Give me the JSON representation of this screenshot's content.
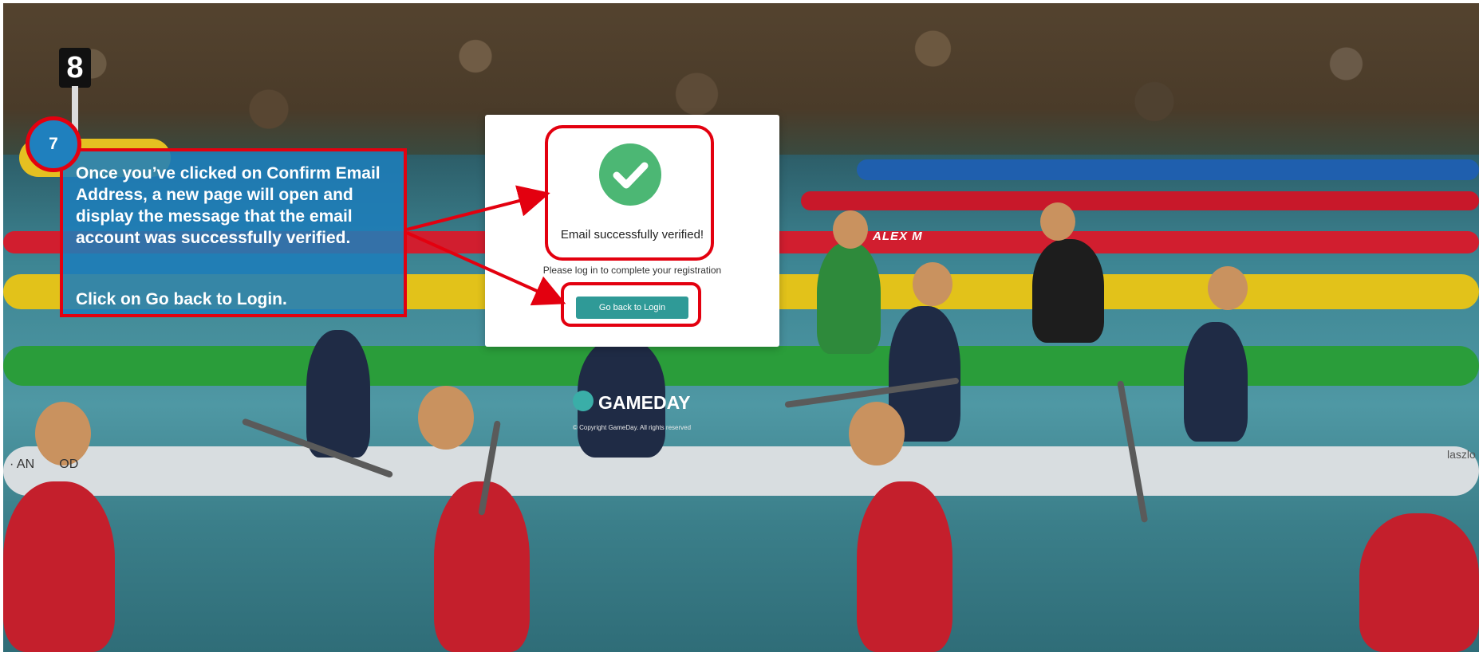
{
  "card": {
    "title": "Email successfully verified!",
    "subtitle": "Please log in to complete your registration",
    "button_label": "Go back to Login"
  },
  "callout": {
    "step_number": "7",
    "line1": "Once you’ve clicked on Confirm Email Address, a new page will open and display the message that the email account was successfully verified.",
    "line2": "Click on Go back to Login."
  },
  "background": {
    "lane_marker": "8",
    "boat_name_left": "· AN",
    "boat_name_left_suffix": "OD",
    "boat_name_right": "laszlo",
    "sponsor_text": "ALEX M"
  },
  "brand": {
    "name": "GAMEDAY",
    "copyright": "© Copyright GameDay. All rights reserved"
  },
  "colors": {
    "accent_button": "#2f9a97",
    "success_check": "#4cb774",
    "highlight_red": "#e3000f",
    "callout_blue": "#1e7db9"
  }
}
